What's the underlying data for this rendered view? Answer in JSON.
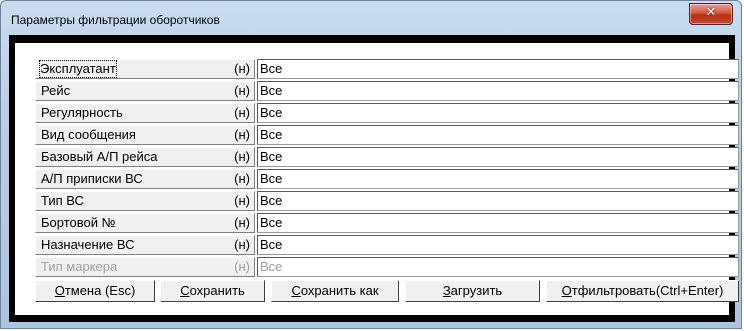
{
  "window": {
    "title": "Параметры фильтрации оборотчиков",
    "close_icon": "close-icon",
    "close_glyph": "✕"
  },
  "filters": [
    {
      "label": "Эксплуатант",
      "mark": "(н)",
      "value": "Все",
      "enabled": true
    },
    {
      "label": "Рейс",
      "mark": "(н)",
      "value": "Все",
      "enabled": true
    },
    {
      "label": "Регулярность",
      "mark": "(н)",
      "value": "Все",
      "enabled": true
    },
    {
      "label": "Вид сообщения",
      "mark": "(н)",
      "value": "Все",
      "enabled": true
    },
    {
      "label": "Базовый А/П рейса",
      "mark": "(н)",
      "value": "Все",
      "enabled": true
    },
    {
      "label": "А/П приписки ВС",
      "mark": "(н)",
      "value": "Все",
      "enabled": true
    },
    {
      "label": "Тип ВС",
      "mark": "(н)",
      "value": "Все",
      "enabled": true
    },
    {
      "label": "Бортовой №",
      "mark": "(н)",
      "value": "Все",
      "enabled": true
    },
    {
      "label": "Назначение ВС",
      "mark": "(н)",
      "value": "Все",
      "enabled": true
    },
    {
      "label": "Тип маркера",
      "mark": "(н)",
      "value": "Все",
      "enabled": false
    }
  ],
  "buttons": {
    "cancel": {
      "hotkey": "О",
      "rest": "тмена (Esc)"
    },
    "save": {
      "hotkey": "С",
      "rest": "охранить"
    },
    "saveas": {
      "hotkey": "С",
      "rest": "охранить как"
    },
    "load": {
      "hotkey": "З",
      "rest": "агрузить"
    },
    "filter": {
      "hotkey": "О",
      "rest": "тфильтровать(Ctrl+Enter)"
    }
  }
}
